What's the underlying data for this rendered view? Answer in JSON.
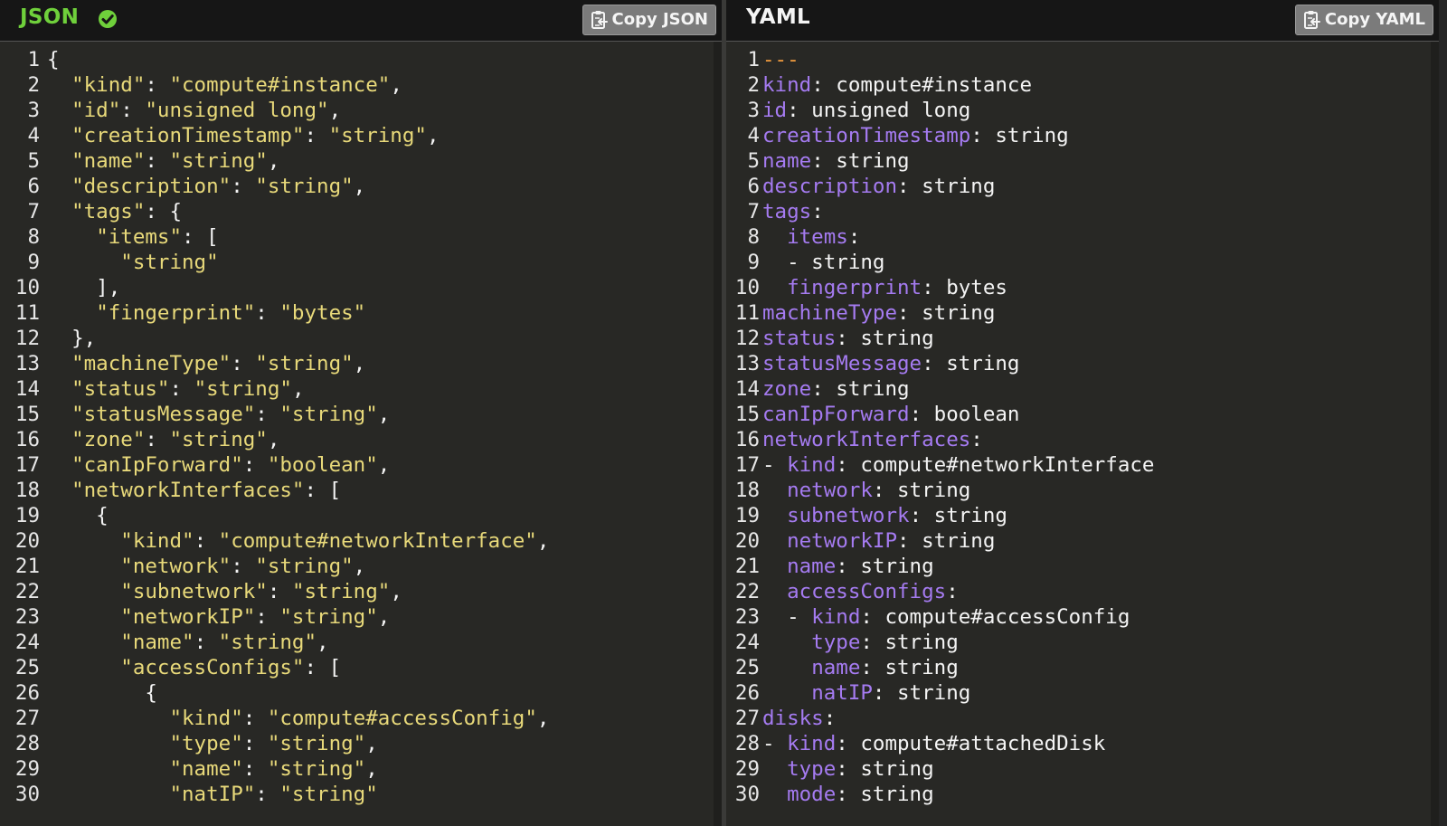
{
  "json_pane": {
    "title": "JSON",
    "copy_label": "Copy JSON",
    "lines": [
      [
        [
          "p",
          "{"
        ]
      ],
      [
        [
          "p",
          "  "
        ],
        [
          "s",
          "\"kind\""
        ],
        [
          "p",
          ": "
        ],
        [
          "s",
          "\"compute#instance\""
        ],
        [
          "p",
          ","
        ]
      ],
      [
        [
          "p",
          "  "
        ],
        [
          "s",
          "\"id\""
        ],
        [
          "p",
          ": "
        ],
        [
          "s",
          "\"unsigned long\""
        ],
        [
          "p",
          ","
        ]
      ],
      [
        [
          "p",
          "  "
        ],
        [
          "s",
          "\"creationTimestamp\""
        ],
        [
          "p",
          ": "
        ],
        [
          "s",
          "\"string\""
        ],
        [
          "p",
          ","
        ]
      ],
      [
        [
          "p",
          "  "
        ],
        [
          "s",
          "\"name\""
        ],
        [
          "p",
          ": "
        ],
        [
          "s",
          "\"string\""
        ],
        [
          "p",
          ","
        ]
      ],
      [
        [
          "p",
          "  "
        ],
        [
          "s",
          "\"description\""
        ],
        [
          "p",
          ": "
        ],
        [
          "s",
          "\"string\""
        ],
        [
          "p",
          ","
        ]
      ],
      [
        [
          "p",
          "  "
        ],
        [
          "s",
          "\"tags\""
        ],
        [
          "p",
          ": {"
        ]
      ],
      [
        [
          "p",
          "    "
        ],
        [
          "s",
          "\"items\""
        ],
        [
          "p",
          ": ["
        ]
      ],
      [
        [
          "p",
          "      "
        ],
        [
          "s",
          "\"string\""
        ]
      ],
      [
        [
          "p",
          "    ],"
        ]
      ],
      [
        [
          "p",
          "    "
        ],
        [
          "s",
          "\"fingerprint\""
        ],
        [
          "p",
          ": "
        ],
        [
          "s",
          "\"bytes\""
        ]
      ],
      [
        [
          "p",
          "  },"
        ]
      ],
      [
        [
          "p",
          "  "
        ],
        [
          "s",
          "\"machineType\""
        ],
        [
          "p",
          ": "
        ],
        [
          "s",
          "\"string\""
        ],
        [
          "p",
          ","
        ]
      ],
      [
        [
          "p",
          "  "
        ],
        [
          "s",
          "\"status\""
        ],
        [
          "p",
          ": "
        ],
        [
          "s",
          "\"string\""
        ],
        [
          "p",
          ","
        ]
      ],
      [
        [
          "p",
          "  "
        ],
        [
          "s",
          "\"statusMessage\""
        ],
        [
          "p",
          ": "
        ],
        [
          "s",
          "\"string\""
        ],
        [
          "p",
          ","
        ]
      ],
      [
        [
          "p",
          "  "
        ],
        [
          "s",
          "\"zone\""
        ],
        [
          "p",
          ": "
        ],
        [
          "s",
          "\"string\""
        ],
        [
          "p",
          ","
        ]
      ],
      [
        [
          "p",
          "  "
        ],
        [
          "s",
          "\"canIpForward\""
        ],
        [
          "p",
          ": "
        ],
        [
          "s",
          "\"boolean\""
        ],
        [
          "p",
          ","
        ]
      ],
      [
        [
          "p",
          "  "
        ],
        [
          "s",
          "\"networkInterfaces\""
        ],
        [
          "p",
          ": ["
        ]
      ],
      [
        [
          "p",
          "    {"
        ]
      ],
      [
        [
          "p",
          "      "
        ],
        [
          "s",
          "\"kind\""
        ],
        [
          "p",
          ": "
        ],
        [
          "s",
          "\"compute#networkInterface\""
        ],
        [
          "p",
          ","
        ]
      ],
      [
        [
          "p",
          "      "
        ],
        [
          "s",
          "\"network\""
        ],
        [
          "p",
          ": "
        ],
        [
          "s",
          "\"string\""
        ],
        [
          "p",
          ","
        ]
      ],
      [
        [
          "p",
          "      "
        ],
        [
          "s",
          "\"subnetwork\""
        ],
        [
          "p",
          ": "
        ],
        [
          "s",
          "\"string\""
        ],
        [
          "p",
          ","
        ]
      ],
      [
        [
          "p",
          "      "
        ],
        [
          "s",
          "\"networkIP\""
        ],
        [
          "p",
          ": "
        ],
        [
          "s",
          "\"string\""
        ],
        [
          "p",
          ","
        ]
      ],
      [
        [
          "p",
          "      "
        ],
        [
          "s",
          "\"name\""
        ],
        [
          "p",
          ": "
        ],
        [
          "s",
          "\"string\""
        ],
        [
          "p",
          ","
        ]
      ],
      [
        [
          "p",
          "      "
        ],
        [
          "s",
          "\"accessConfigs\""
        ],
        [
          "p",
          ": ["
        ]
      ],
      [
        [
          "p",
          "        {"
        ]
      ],
      [
        [
          "p",
          "          "
        ],
        [
          "s",
          "\"kind\""
        ],
        [
          "p",
          ": "
        ],
        [
          "s",
          "\"compute#accessConfig\""
        ],
        [
          "p",
          ","
        ]
      ],
      [
        [
          "p",
          "          "
        ],
        [
          "s",
          "\"type\""
        ],
        [
          "p",
          ": "
        ],
        [
          "s",
          "\"string\""
        ],
        [
          "p",
          ","
        ]
      ],
      [
        [
          "p",
          "          "
        ],
        [
          "s",
          "\"name\""
        ],
        [
          "p",
          ": "
        ],
        [
          "s",
          "\"string\""
        ],
        [
          "p",
          ","
        ]
      ],
      [
        [
          "p",
          "          "
        ],
        [
          "s",
          "\"natIP\""
        ],
        [
          "p",
          ": "
        ],
        [
          "s",
          "\"string\""
        ]
      ]
    ]
  },
  "yaml_pane": {
    "title": "YAML",
    "copy_label": "Copy YAML",
    "lines": [
      [
        [
          "dd",
          "---"
        ]
      ],
      [
        [
          "k",
          "kind"
        ],
        [
          "p",
          ": compute#instance"
        ]
      ],
      [
        [
          "k",
          "id"
        ],
        [
          "p",
          ": unsigned long"
        ]
      ],
      [
        [
          "k",
          "creationTimestamp"
        ],
        [
          "p",
          ": string"
        ]
      ],
      [
        [
          "k",
          "name"
        ],
        [
          "p",
          ": string"
        ]
      ],
      [
        [
          "k",
          "description"
        ],
        [
          "p",
          ": string"
        ]
      ],
      [
        [
          "k",
          "tags"
        ],
        [
          "p",
          ":"
        ]
      ],
      [
        [
          "p",
          "  "
        ],
        [
          "k",
          "items"
        ],
        [
          "p",
          ":"
        ]
      ],
      [
        [
          "p",
          "  - string"
        ]
      ],
      [
        [
          "p",
          "  "
        ],
        [
          "k",
          "fingerprint"
        ],
        [
          "p",
          ": bytes"
        ]
      ],
      [
        [
          "k",
          "machineType"
        ],
        [
          "p",
          ": string"
        ]
      ],
      [
        [
          "k",
          "status"
        ],
        [
          "p",
          ": string"
        ]
      ],
      [
        [
          "k",
          "statusMessage"
        ],
        [
          "p",
          ": string"
        ]
      ],
      [
        [
          "k",
          "zone"
        ],
        [
          "p",
          ": string"
        ]
      ],
      [
        [
          "k",
          "canIpForward"
        ],
        [
          "p",
          ": boolean"
        ]
      ],
      [
        [
          "k",
          "networkInterfaces"
        ],
        [
          "p",
          ":"
        ]
      ],
      [
        [
          "p",
          "- "
        ],
        [
          "k",
          "kind"
        ],
        [
          "p",
          ": compute#networkInterface"
        ]
      ],
      [
        [
          "p",
          "  "
        ],
        [
          "k",
          "network"
        ],
        [
          "p",
          ": string"
        ]
      ],
      [
        [
          "p",
          "  "
        ],
        [
          "k",
          "subnetwork"
        ],
        [
          "p",
          ": string"
        ]
      ],
      [
        [
          "p",
          "  "
        ],
        [
          "k",
          "networkIP"
        ],
        [
          "p",
          ": string"
        ]
      ],
      [
        [
          "p",
          "  "
        ],
        [
          "k",
          "name"
        ],
        [
          "p",
          ": string"
        ]
      ],
      [
        [
          "p",
          "  "
        ],
        [
          "k",
          "accessConfigs"
        ],
        [
          "p",
          ":"
        ]
      ],
      [
        [
          "p",
          "  - "
        ],
        [
          "k",
          "kind"
        ],
        [
          "p",
          ": compute#accessConfig"
        ]
      ],
      [
        [
          "p",
          "    "
        ],
        [
          "k",
          "type"
        ],
        [
          "p",
          ": string"
        ]
      ],
      [
        [
          "p",
          "    "
        ],
        [
          "k",
          "name"
        ],
        [
          "p",
          ": string"
        ]
      ],
      [
        [
          "p",
          "    "
        ],
        [
          "k",
          "natIP"
        ],
        [
          "p",
          ": string"
        ]
      ],
      [
        [
          "k",
          "disks"
        ],
        [
          "p",
          ":"
        ]
      ],
      [
        [
          "p",
          "- "
        ],
        [
          "k",
          "kind"
        ],
        [
          "p",
          ": compute#attachedDisk"
        ]
      ],
      [
        [
          "p",
          "  "
        ],
        [
          "k",
          "type"
        ],
        [
          "p",
          ": string"
        ]
      ],
      [
        [
          "p",
          "  "
        ],
        [
          "k",
          "mode"
        ],
        [
          "p",
          ": string"
        ]
      ]
    ]
  },
  "icons": {
    "valid": "check-circle-icon",
    "copy": "clipboard-icon"
  },
  "colors": {
    "json_title": "#6fd03b",
    "string": "#e8d97a",
    "yaml_key": "#a57bf1",
    "doc_start": "#f09a3e",
    "text": "#f4f4f4"
  }
}
